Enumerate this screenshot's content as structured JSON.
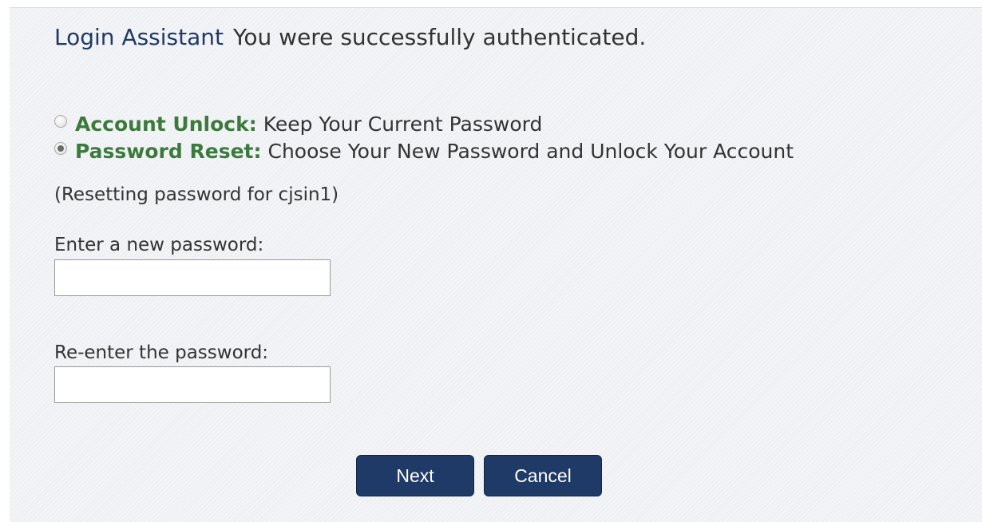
{
  "header": {
    "app_name": "Login Assistant",
    "status_message": "You were successfully authenticated."
  },
  "options": [
    {
      "label": "Account Unlock:",
      "description": "Keep Your Current Password",
      "selected": false
    },
    {
      "label": "Password Reset:",
      "description": "Choose Your New Password and Unlock Your Account",
      "selected": true
    }
  ],
  "note": "(Resetting password for cjsin1)",
  "fields": {
    "new_password": {
      "label": "Enter a new password:",
      "value": ""
    },
    "confirm_password": {
      "label": "Re-enter the password:",
      "value": ""
    }
  },
  "buttons": {
    "next": "Next",
    "cancel": "Cancel"
  },
  "colors": {
    "accent": "#1f3a66",
    "option_label": "#3c7a3c",
    "background": "#eef0f4"
  }
}
